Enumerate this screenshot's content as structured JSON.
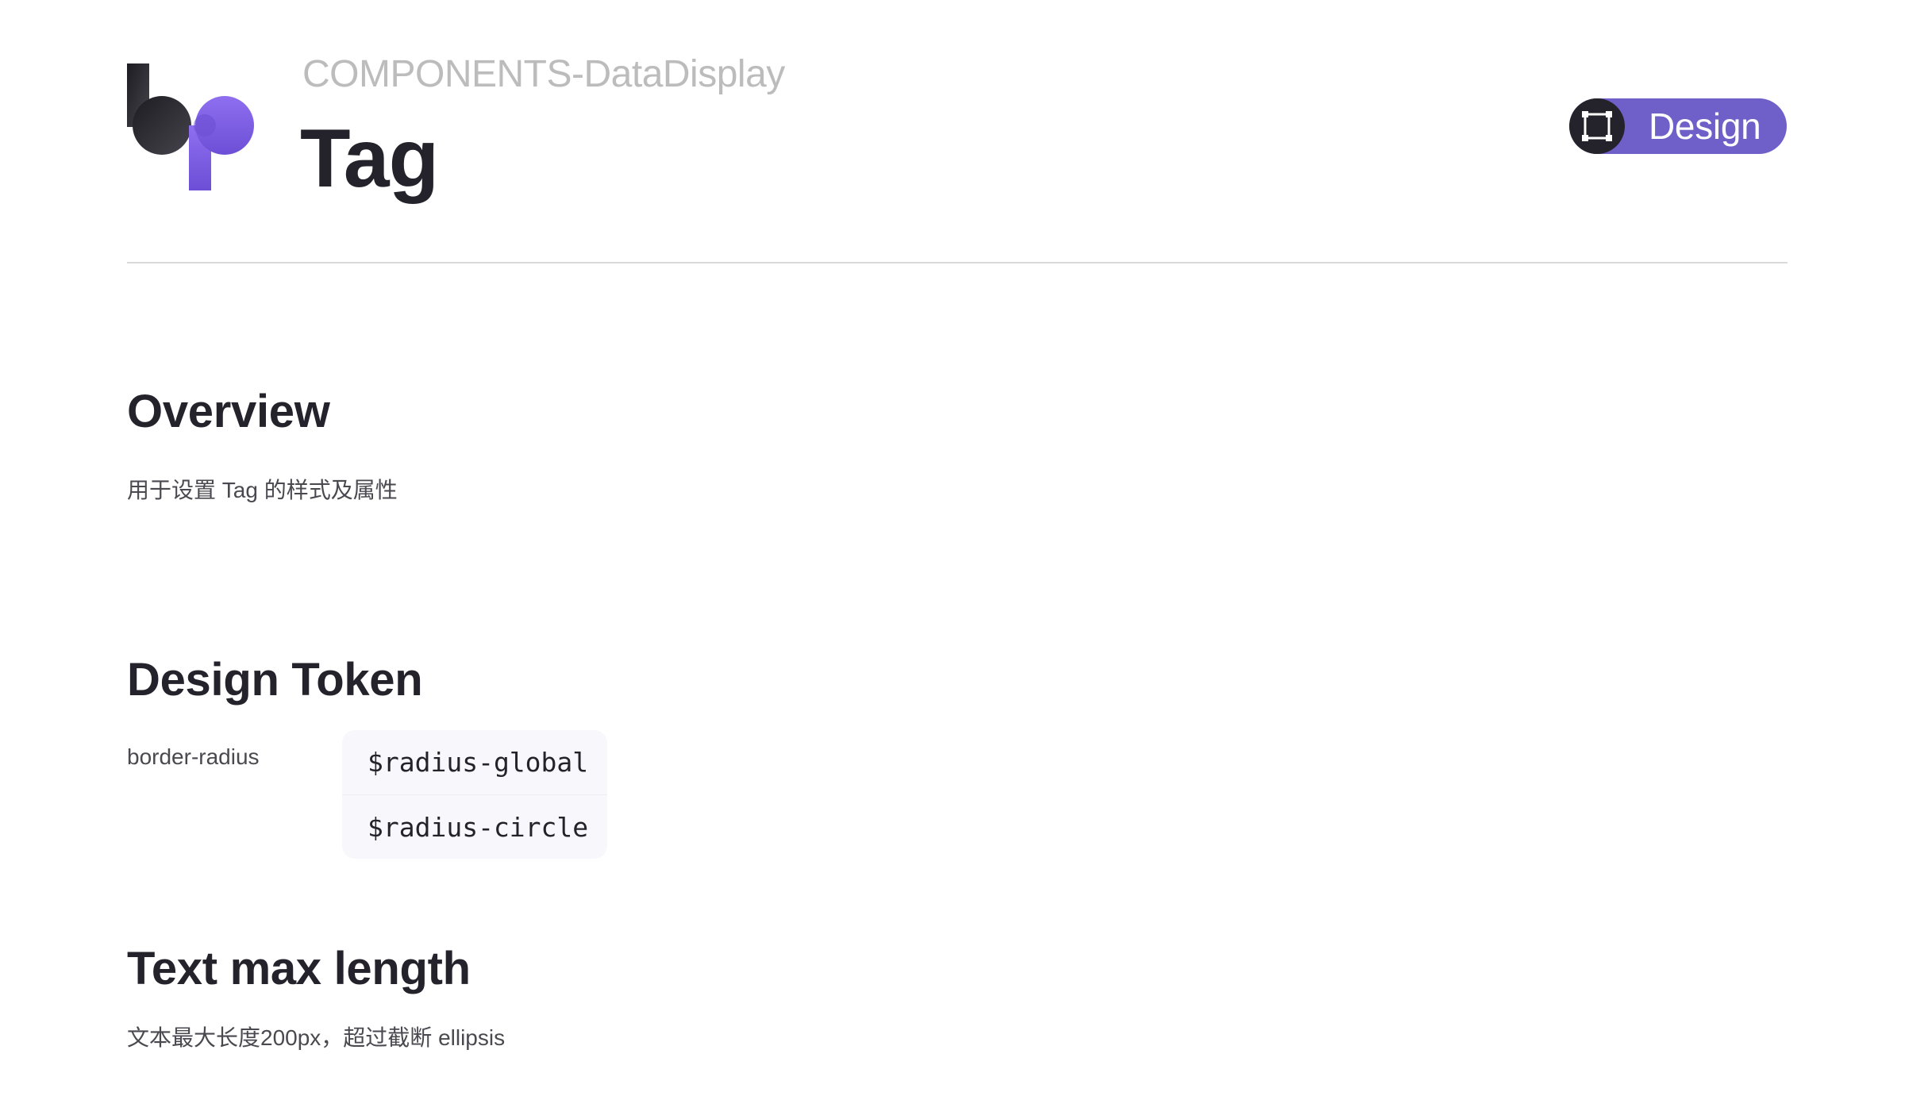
{
  "header": {
    "eyebrow": "COMPONENTS-DataDisplay",
    "title": "Tag",
    "badge": {
      "label": "Design",
      "icon": "frame-icon",
      "color": "#6f5fc8"
    }
  },
  "brand": {
    "logo": "bp-logo",
    "colors": {
      "dark": "#24232b",
      "purple": "#7b5ce0"
    }
  },
  "sections": {
    "overview": {
      "heading": "Overview",
      "text": "用于设置 Tag 的样式及属性"
    },
    "design_token": {
      "heading": "Design Token",
      "rows": [
        {
          "property": "border-radius",
          "tokens": [
            "$radius-global",
            "$radius-circle"
          ]
        }
      ]
    },
    "text_max_length": {
      "heading": "Text max length",
      "text": "文本最大长度200px，超过截断 ellipsis"
    }
  }
}
